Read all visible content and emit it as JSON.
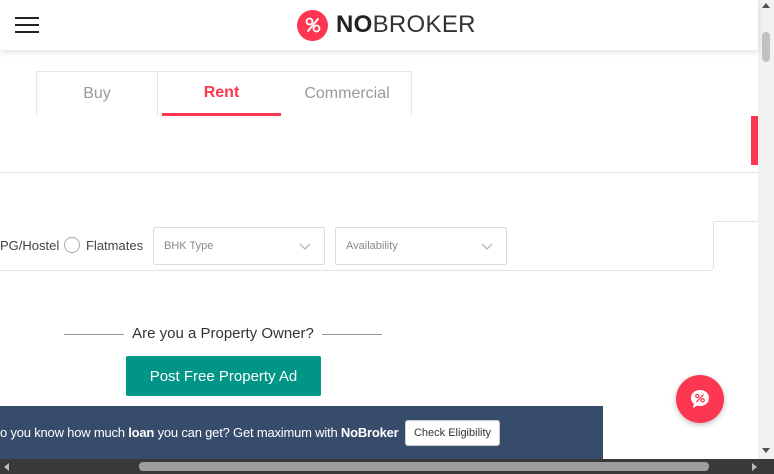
{
  "header": {
    "logo_bold": "NO",
    "logo_rest": "BROKER"
  },
  "tabs": [
    {
      "label": "Buy",
      "active": false
    },
    {
      "label": "Rent",
      "active": true
    },
    {
      "label": "Commercial",
      "active": false
    }
  ],
  "search": {
    "value": "",
    "placeholder": ""
  },
  "filters": {
    "pg_hostel_label": "PG/Hostel",
    "flatmates_label": "Flatmates",
    "bhk_type_label": "BHK Type",
    "availability_label": "Availability"
  },
  "owner": {
    "question": "Are you a Property Owner?",
    "post_button": "Post Free Property Ad"
  },
  "banner": {
    "text_pre": "o you know how much ",
    "text_bold1": "loan",
    "text_mid": " you can get? Get maximum with ",
    "text_bold2": "NoBroker",
    "check_button": "Check Eligibility"
  },
  "colors": {
    "brand": "#fd3752",
    "post_button": "#009587",
    "banner_bg": "#374b6b"
  },
  "icons": {
    "menu": "hamburger-icon",
    "logo": "nobroker-logo-icon",
    "chevron": "chevron-down-icon",
    "chat": "chat-icon"
  }
}
